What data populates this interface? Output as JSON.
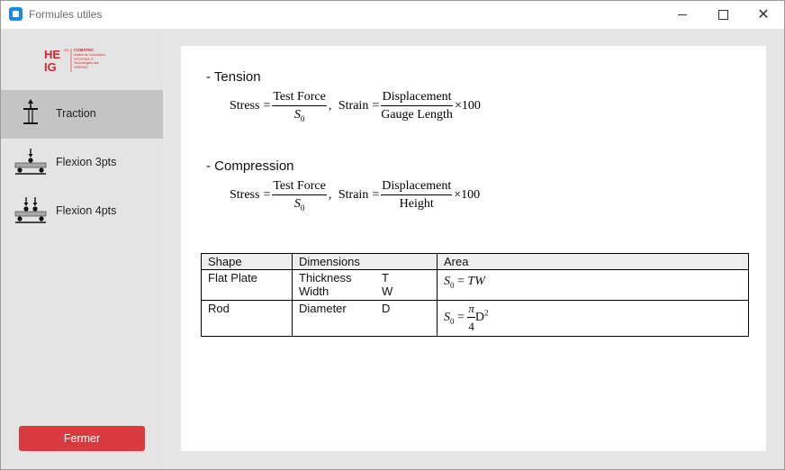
{
  "window": {
    "title": "Formules utiles",
    "minimize_label": "—",
    "maximize_label": "☐",
    "close_label": "✕"
  },
  "sidebar": {
    "logo": {
      "text": "HEIG-VD COMATEC",
      "lines": [
        "COMATEC",
        "Institut de Conception",
        "mécanique et",
        "Technologies des",
        "matériaux"
      ]
    },
    "items": [
      {
        "label": "Traction",
        "icon": "traction-test-icon",
        "active": true
      },
      {
        "label": "Flexion 3pts",
        "icon": "three-point-bending-icon",
        "active": false
      },
      {
        "label": "Flexion 4pts",
        "icon": "four-point-bending-icon",
        "active": false
      }
    ],
    "close_button": "Fermer"
  },
  "content": {
    "tension": {
      "heading": "- Tension",
      "stress_label": "Stress",
      "stress_num": "Test Force",
      "stress_den_sym": "S",
      "stress_den_sub": "0",
      "strain_label": "Strain",
      "strain_num": "Displacement",
      "strain_den": "Gauge Length",
      "multiplier": "×100"
    },
    "compression": {
      "heading": "- Compression",
      "stress_label": "Stress",
      "stress_num": "Test Force",
      "stress_den_sym": "S",
      "stress_den_sub": "0",
      "strain_label": "Strain",
      "strain_num": "Displacement",
      "strain_den": "Height",
      "multiplier": "×100"
    },
    "table": {
      "headers": [
        "Shape",
        "Dimensions",
        "Area"
      ],
      "rows": [
        {
          "shape": "Flat Plate",
          "dims": [
            {
              "name": "Thickness",
              "sym": "T"
            },
            {
              "name": "Width",
              "sym": "W"
            }
          ],
          "area": {
            "lhs": "S",
            "sub": "0",
            "rhs": "TW"
          }
        },
        {
          "shape": "Rod",
          "dims": [
            {
              "name": "Diameter",
              "sym": "D"
            }
          ],
          "area": {
            "lhs": "S",
            "sub": "0",
            "num": "π",
            "den": "4",
            "rhs": "D",
            "sup": "2"
          }
        }
      ]
    }
  },
  "colors": {
    "accent": "#d93a3f",
    "logo_red": "#d6262c",
    "active_bg": "#c4c4c4",
    "sidebar_bg": "#e4e4e4",
    "app_bg": "#e6e6e6"
  }
}
